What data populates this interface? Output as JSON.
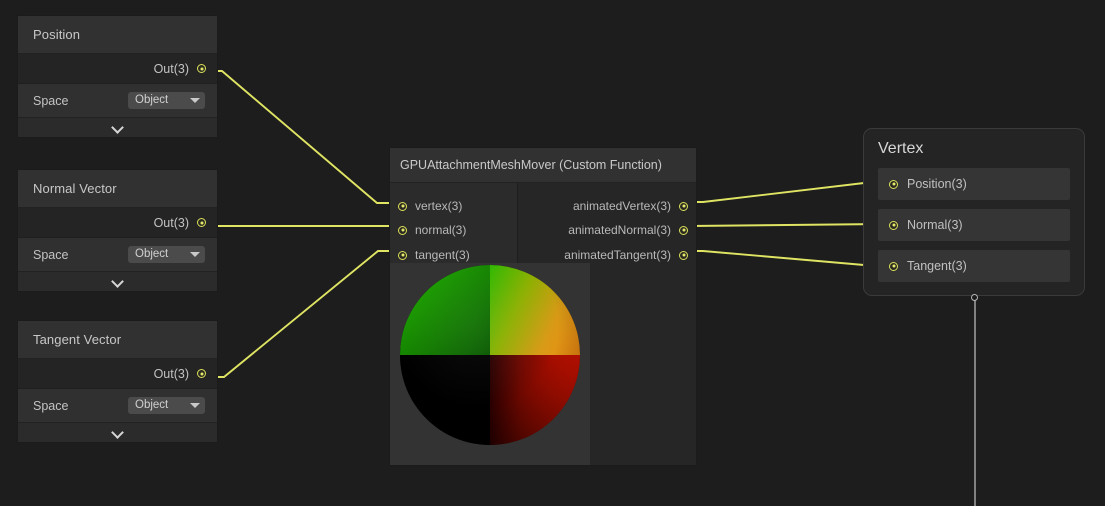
{
  "canvas": {
    "background": "#1d1d1d",
    "wire_color": "#dfe463",
    "port_color": "#e4e96a",
    "node_body": "#262626",
    "node_header": "#313131"
  },
  "property_nodes": [
    {
      "title": "Position",
      "out_label": "Out(3)",
      "property_label": "Space",
      "dropdown_value": "Object",
      "dropdown_icon": "chevron-down-icon",
      "expander_icon": "chevron-down-icon"
    },
    {
      "title": "Normal Vector",
      "out_label": "Out(3)",
      "property_label": "Space",
      "dropdown_value": "Object",
      "dropdown_icon": "chevron-down-icon",
      "expander_icon": "chevron-down-icon"
    },
    {
      "title": "Tangent Vector",
      "out_label": "Out(3)",
      "property_label": "Space",
      "dropdown_value": "Object",
      "dropdown_icon": "chevron-down-icon",
      "expander_icon": "chevron-down-icon"
    }
  ],
  "function_node": {
    "title": "GPUAttachmentMeshMover (Custom Function)",
    "inputs": [
      {
        "label": "vertex(3)"
      },
      {
        "label": "normal(3)"
      },
      {
        "label": "tangent(3)"
      }
    ],
    "outputs": [
      {
        "label": "animatedVertex(3)"
      },
      {
        "label": "animatedNormal(3)"
      },
      {
        "label": "animatedTangent(3)"
      }
    ],
    "preview": {
      "name": "sphere-preview",
      "quadrant_top_left": "#1ea000",
      "quadrant_top_right": "#f08a10",
      "quadrant_bottom_left": "#000000",
      "quadrant_bottom_right": "#d41000"
    }
  },
  "vertex_node": {
    "title": "Vertex",
    "rows": [
      {
        "label": "Position(3)"
      },
      {
        "label": "Normal(3)"
      },
      {
        "label": "Tangent(3)"
      }
    ]
  }
}
